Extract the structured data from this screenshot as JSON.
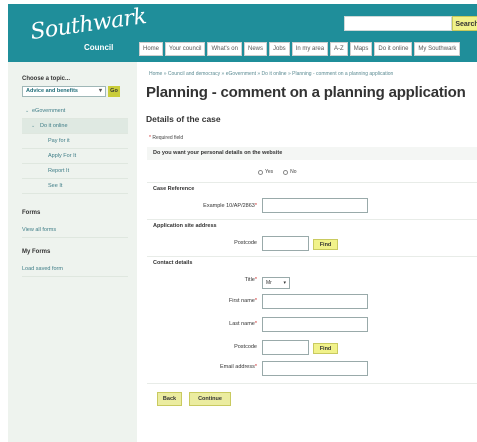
{
  "header": {
    "logo_script": "Southwark",
    "logo_sub": "Council",
    "search_button": "Search",
    "nav_tabs": [
      "Home",
      "Your council",
      "What's on",
      "News",
      "Jobs",
      "In my area",
      "A-Z",
      "Maps",
      "Do it online",
      "My Southwark"
    ]
  },
  "sidebar": {
    "choose_topic": "Choose a topic...",
    "topic_selected": "Advice and benefits",
    "go_button": "Go",
    "items": [
      {
        "label": "eGovernment"
      },
      {
        "label": "Do it online"
      },
      {
        "label": "Pay for it"
      },
      {
        "label": "Apply For It"
      },
      {
        "label": "Report It"
      },
      {
        "label": "See It"
      }
    ],
    "forms_heading": "Forms",
    "view_all_forms": "View all forms",
    "my_forms_heading": "My Forms",
    "load_saved_form": "Load saved form"
  },
  "main": {
    "breadcrumb": "Home  »  Council and democracy  »  eGovernment  »  Do it online  »  Planning - comment on a planning application",
    "title": "Planning - comment on a planning application",
    "subtitle": "Details of the case",
    "required_note_star": "*",
    "required_note_text": "Required field",
    "personal_details_question": "Do you want your personal details on the website",
    "yes_label": "Yes",
    "no_label": "No",
    "case_reference_heading": "Case Reference",
    "example_label": "Example 10/AP/2863",
    "site_address_heading": "Application site address",
    "postcode_label": "Postcode",
    "find_label": "Find",
    "contact_heading": "Contact details",
    "title_label": "Title",
    "title_value": "Mr",
    "first_name_label": "First name",
    "last_name_label": "Last name",
    "email_label": "Email address",
    "back_button": "Back",
    "continue_button": "Continue"
  },
  "colors": {
    "header_teal": "#1f8e9a",
    "button_yellow": "#f1f28a",
    "required_red": "#c22222"
  }
}
